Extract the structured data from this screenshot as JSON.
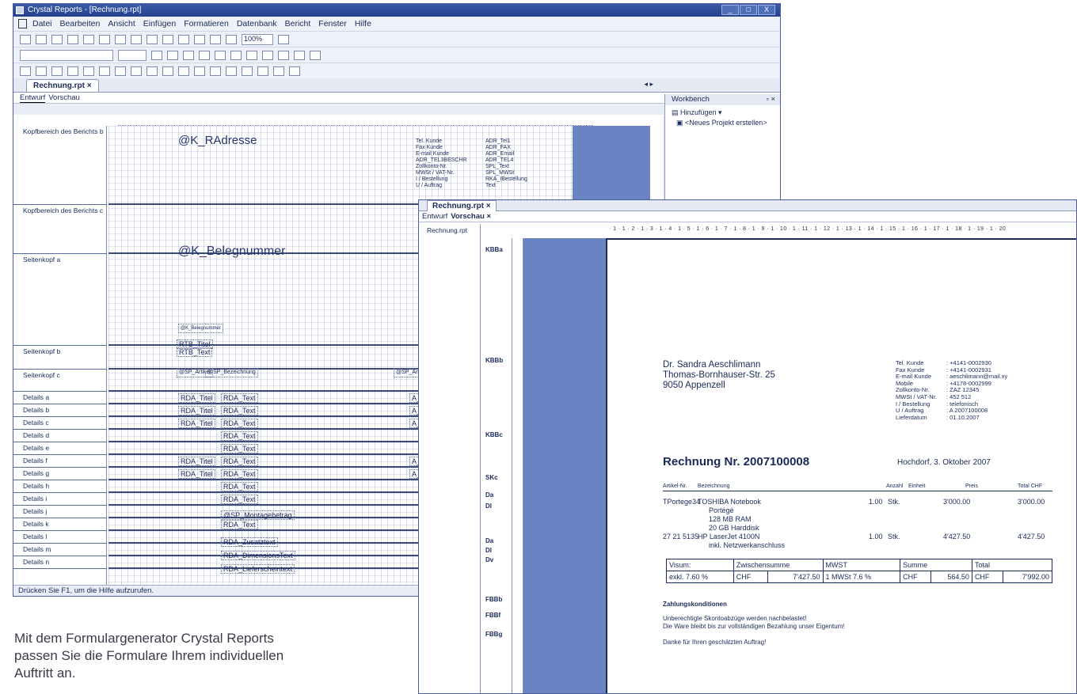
{
  "window": {
    "title": "Crystal Reports - [Rechnung.rpt]",
    "controls": [
      "_",
      "□",
      "X"
    ]
  },
  "menu": [
    "Datei",
    "Bearbeiten",
    "Ansicht",
    "Einfügen",
    "Formatieren",
    "Datenbank",
    "Bericht",
    "Fenster",
    "Hilfe"
  ],
  "toolbar": {
    "zoom": "100%"
  },
  "tab": {
    "label": "Rechnung.rpt ×"
  },
  "subtabs": [
    "Entwurf",
    "Vorschau"
  ],
  "workbench": {
    "title": "Workbench",
    "close": "▫ ×",
    "add": "Hinzufügen ▾",
    "new_project": "<Neues Projekt erstellen>"
  },
  "sections": [
    {
      "label": "Kopfbereich des Berichts b"
    },
    {
      "label": "Kopfbereich des Berichts c"
    },
    {
      "label": "Seitenkopf a"
    },
    {
      "label": "Seitenkopf b"
    },
    {
      "label": "Seitenkopf c"
    },
    {
      "label": "Details a"
    },
    {
      "label": "Details b"
    },
    {
      "label": "Details c"
    },
    {
      "label": "Details d"
    },
    {
      "label": "Details e"
    },
    {
      "label": "Details f"
    },
    {
      "label": "Details g"
    },
    {
      "label": "Details h"
    },
    {
      "label": "Details i"
    },
    {
      "label": "Details j"
    },
    {
      "label": "Details k"
    },
    {
      "label": "Details l"
    },
    {
      "label": "Details m"
    },
    {
      "label": "Details n"
    }
  ],
  "fields": {
    "radresse": "@K_RAdresse",
    "belegnummer": "@K_Belegnummer",
    "belegnummer_small": "@K_Belegnummer",
    "rtb_titel": "RTB_Titel",
    "rtb_text": "RTB_Text",
    "sp_artikel": "@SP_Artikel",
    "sp_bezeichnung": "@SP_Bezeichnung",
    "sp_anzahl": "@SP_Anzahl",
    "rda_titel": "RDA_Titel",
    "rda_text": "RDA_Text",
    "anzahl": "A_Anzahl",
    "sp_montage": "@SP_Montagebetrag",
    "rda_zusatz": "RDA_Zusatztext",
    "rda_dim": "RDA_DimensionsText",
    "rda_liefer": "RDA_Lieferscheintext",
    "header_right_labels": [
      "Tel. Kunde",
      "Fax Kunde",
      "E-mail Kunde",
      "ADR_TEL3BESCHR",
      "Zollkonto-Nr.",
      "MWSt / VAT-Nr.",
      "I / Bestellung",
      "U / Auftrag"
    ],
    "header_right_values": [
      "ADR_Tel1",
      "ADR_FAX",
      "ADR_Email",
      "ADR_TEL4",
      "SPL_Text",
      "SPL_MWSt",
      "RKA_IBestellung",
      "Text"
    ]
  },
  "status": "Drücken Sie F1, um die Hilfe aufzurufen.",
  "preview": {
    "tab": "Rechnung.rpt ×",
    "subtabs": [
      "Entwurf",
      "Vorschau ×"
    ],
    "tree": "Rechnung.rpt",
    "sections": [
      "KBBa",
      "KBBb",
      "KBBc",
      "SKc",
      "Da",
      "Dl",
      "Da",
      "Dl",
      "Dv",
      "FBBb",
      "FBBf",
      "FBBg"
    ],
    "ruler": "· 1 · 1 · 2 · 1 · 3 · 1 · 4 · 1 · 5 · 1 · 6 · 1 · 7 · 1 · 8 · 1 · 9 · 1 · 10 · 1 · 11 · 1 · 12 · 1 · 13 · 1 · 14 · 1 · 15 · 1 · 16 · 1 · 17 · 1 · 18 · 1 · 19 · 1 · 20",
    "address": [
      "Dr. Sandra Aeschlimann",
      "Thomas-Bornhauser-Str. 25",
      "9050 Appenzell"
    ],
    "info_labels": [
      "Tel. Kunde",
      "Fax Kunde",
      "E-mail Kunde",
      "Mobile",
      "Zollkonto-Nr.",
      "MWSt / VAT-Nr.",
      "I / Bestellung",
      "U / Auftrag",
      "Lieferdatum"
    ],
    "info_values": [
      ": +4141-0002930",
      ": +4141-0002931",
      ": aeschlimann@mail.xy",
      ": +4178-0002999",
      ": ZAZ 12345",
      ": 452 512",
      ": telefonisch",
      ": A 2007100008",
      ": 01.10.2007"
    ],
    "invoice_title": "Rechnung Nr. 2007100008",
    "place_date": "Hochdorf, 3. Oktober 2007",
    "col_headers": [
      "Artikel-Nr.",
      "Bezeichnung",
      "Anzahl",
      "Einheit",
      "Preis",
      "Total CHF"
    ],
    "items": [
      {
        "nr": "TPortege34",
        "desc": "TOSHIBA Notebook",
        "qty": "1.00",
        "unit": "Stk.",
        "price": "3'000.00",
        "total": "3'000.00"
      },
      {
        "nr": "27 21 5135",
        "desc": "HP LaserJet 4100N",
        "qty": "1.00",
        "unit": "Stk.",
        "price": "4'427.50",
        "total": "4'427.50"
      }
    ],
    "item1_extra": [
      "Portégé",
      "128 MB RAM",
      "20 GB Harddisk"
    ],
    "item2_extra": [
      "inkl. Netzwerkanschluss"
    ],
    "summary_header": [
      "Visum:",
      "Zwischensumme",
      "MWST",
      "Summe",
      "Total"
    ],
    "summary_values": [
      "exkl. 7.60 %",
      "CHF",
      "7'427.50",
      "1  MWSt 7.6 %",
      "CHF",
      "564.50",
      "CHF",
      "7'992.00"
    ],
    "terms_title": "Zahlungskonditionen",
    "terms_lines": [
      "Unberechtigte Skontoabzüge werden nachbelastet!",
      "Die Ware bleibt bis zur vollständigen Bezahlung unser Eigentum!"
    ],
    "thanks": "Danke für Ihren geschätzten Auftrag!"
  },
  "caption": "Mit dem Formulargenerator Crystal Reports passen Sie die Formulare Ihrem individuellen Auftritt an."
}
